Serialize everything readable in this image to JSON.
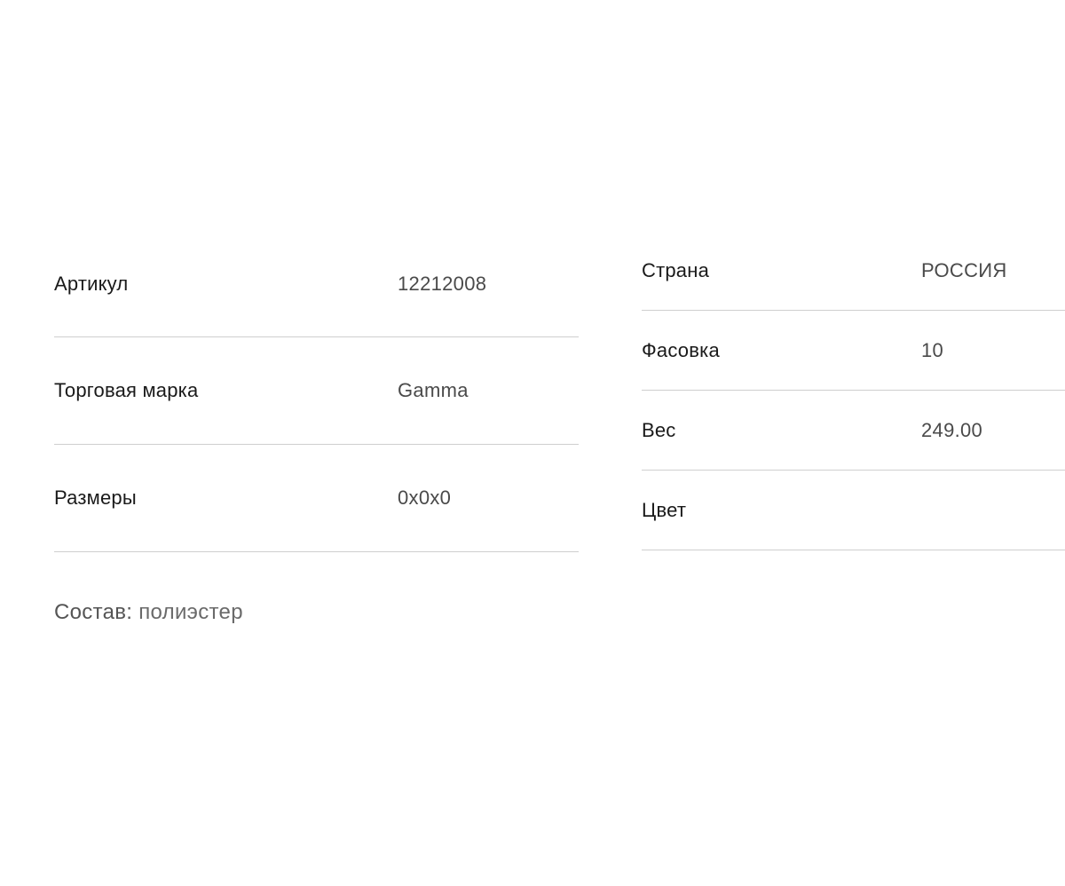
{
  "specs_left": [
    {
      "label": "Артикул",
      "value": "12212008"
    },
    {
      "label": "Торговая марка",
      "value": "Gamma"
    },
    {
      "label": "Размеры",
      "value": "0x0x0"
    }
  ],
  "specs_right": [
    {
      "label": "Страна",
      "value": "РОССИЯ"
    },
    {
      "label": "Фасовка",
      "value": "10"
    },
    {
      "label": "Вес",
      "value": "249.00"
    },
    {
      "label": "Цвет",
      "value": ""
    }
  ],
  "composition": {
    "label": "Состав:",
    "value": "полиэстер"
  }
}
